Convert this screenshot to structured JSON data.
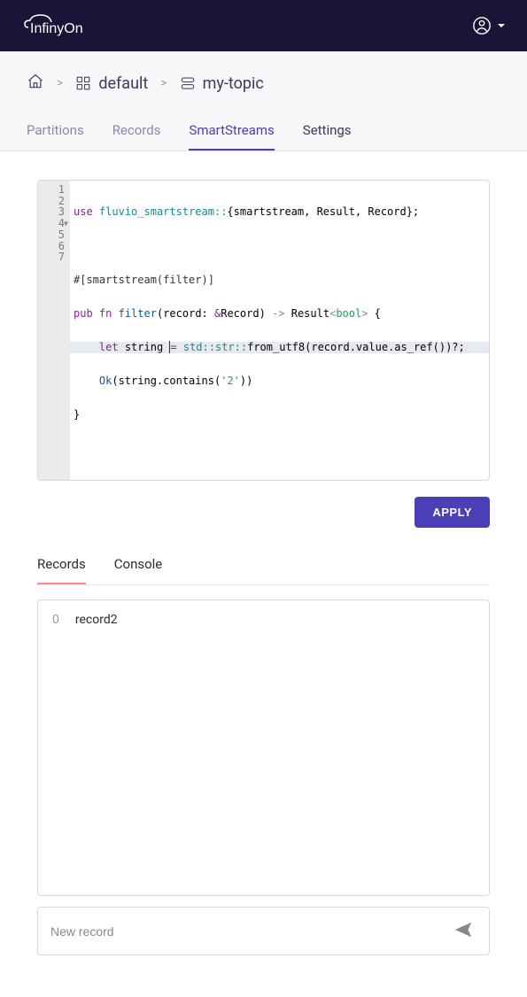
{
  "header": {
    "logo_text": "InfinyOn"
  },
  "breadcrumb": {
    "cluster": "default",
    "topic": "my-topic"
  },
  "tabs": {
    "partitions": "Partitions",
    "records": "Records",
    "smartstreams": "SmartStreams",
    "settings": "Settings"
  },
  "code": {
    "lines": [
      "1",
      "2",
      "3",
      "4",
      "5",
      "6",
      "7"
    ],
    "l1": {
      "use": "use",
      "path": "fluvio_smartstream::",
      "rest": "{smartstream, Result, Record};"
    },
    "l3": "#[smartstream(filter)]",
    "l4": {
      "pub": "pub",
      "fn": "fn",
      "name": "filter",
      "p1": "(record: ",
      "amp": "&",
      "type": "Record",
      "p2": ") ",
      "arrow": "->",
      "res": " Result",
      "lt": "<",
      "bool": "bool",
      "gt": ">",
      "brace": " {"
    },
    "l5": {
      "indent": "    ",
      "let": "let",
      "var": " string ",
      "eq": "=",
      "sp": " ",
      "path": "std::str::",
      "call": "from_utf8(record.value.as_ref())?;"
    },
    "l6": {
      "indent": "    ",
      "ok": "Ok",
      "p1": "(string.contains(",
      "str": "'2'",
      "p2": "))"
    },
    "l7": "}"
  },
  "apply_label": "APPLY",
  "sub_tabs": {
    "records": "Records",
    "console": "Console"
  },
  "records": [
    {
      "idx": "0",
      "val": "record2"
    }
  ],
  "new_record_placeholder": "New record"
}
